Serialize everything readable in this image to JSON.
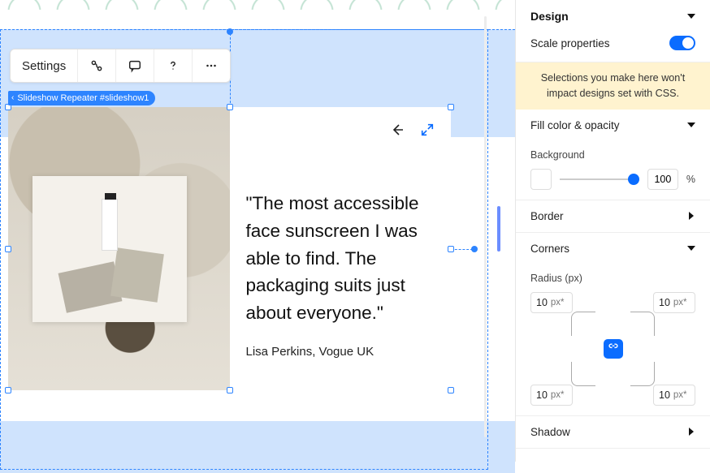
{
  "toolbar": {
    "settings_label": "Settings"
  },
  "breadcrumb": {
    "label": "Slideshow Repeater #slideshow1"
  },
  "slide": {
    "quote": "\"The most accessible face sunscreen I was able to find. The packaging suits just about everyone.\"",
    "byline": "Lisa Perkins, Vogue UK"
  },
  "panel": {
    "design_title": "Design",
    "scale_label": "Scale properties",
    "css_note": "Selections you make here won't impact designs set with CSS.",
    "fill_title": "Fill color & opacity",
    "background_label": "Background",
    "opacity_value": "100",
    "opacity_unit": "%",
    "border_title": "Border",
    "corners_title": "Corners",
    "radius_label": "Radius (px)",
    "radius_unit": "px*",
    "radius": {
      "tl": "10",
      "tr": "10",
      "bl": "10",
      "br": "10"
    },
    "shadow_title": "Shadow"
  }
}
